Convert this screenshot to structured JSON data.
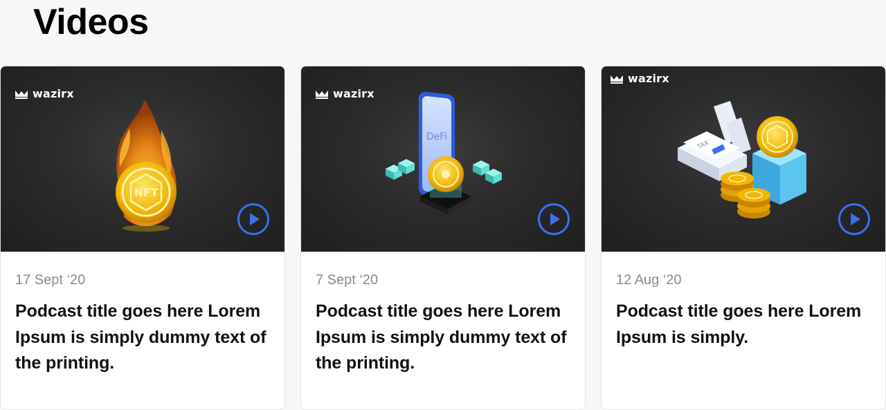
{
  "section": {
    "title": "Videos"
  },
  "brand_name": "wazirx",
  "cards": [
    {
      "date": "17 Sept ‘20",
      "title": "Podcast title goes here Lorem Ipsum is simply dummy text of the printing.",
      "image_icon": "nft-fire-coin-icon",
      "image_label": "NFT"
    },
    {
      "date": "7 Sept ‘20",
      "title": "Podcast title goes here Lorem Ipsum is simply dummy text of the printing.",
      "image_icon": "defi-phone-coin-icon",
      "image_label": "DeFi"
    },
    {
      "date": "12 Aug ‘20",
      "title": "Podcast title goes here Lorem Ipsum is simply.",
      "image_icon": "tax-nft-coins-icon",
      "image_label": "TAX"
    }
  ],
  "colors": {
    "accent": "#3a6ff0",
    "coin_gold": "#f2b705",
    "thumb_bg": "#2b2b2b",
    "cube_teal": "#5ce0d8",
    "cube_blue": "#5bc4ef"
  }
}
